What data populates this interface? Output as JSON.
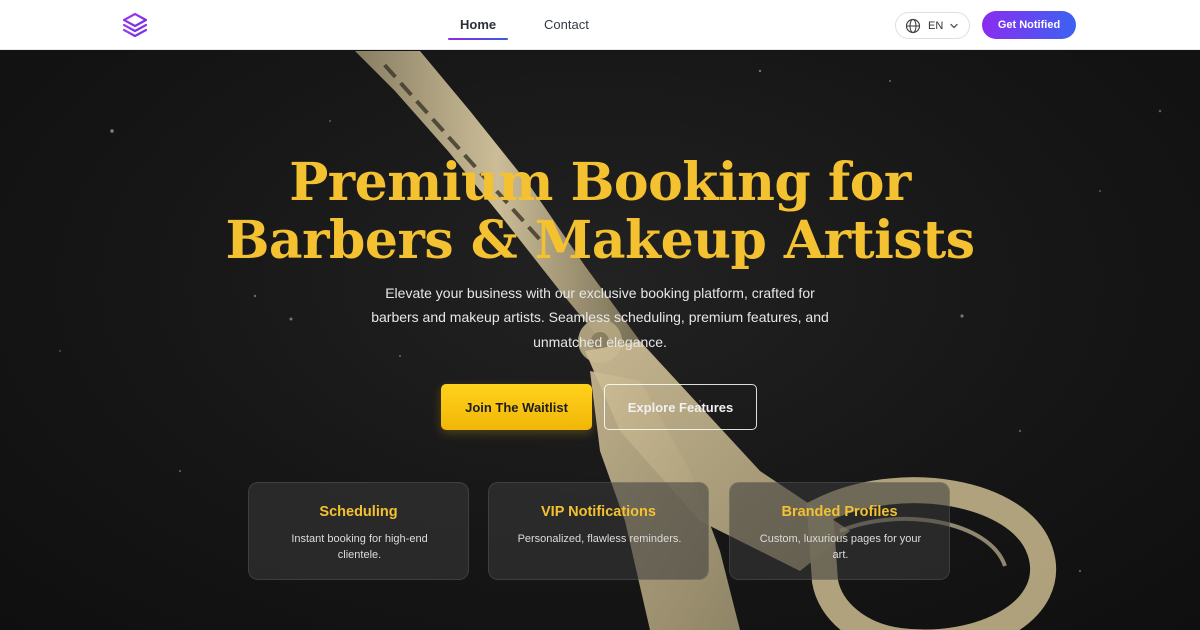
{
  "nav": {
    "logo_icon": "layers-icon",
    "links": [
      {
        "label": "Home",
        "active": true
      },
      {
        "label": "Contact",
        "active": false
      }
    ],
    "language": {
      "code": "EN",
      "icon": "globe-icon"
    },
    "cta_label": "Get Notified"
  },
  "hero": {
    "title_lines": [
      "Premium Booking for",
      "Barbers & Makeup Artists"
    ],
    "description_lines": [
      "Elevate your business with our exclusive booking platform, crafted for",
      "barbers and makeup artists. Seamless scheduling, premium features, and",
      "unmatched elegance."
    ],
    "primary_button": "Join The Waitlist",
    "secondary_button": "Explore Features"
  },
  "features": [
    {
      "title": "Scheduling",
      "desc_lines": [
        "Instant booking for high-end",
        "clientele."
      ]
    },
    {
      "title": "VIP Notifications",
      "desc_lines": [
        "Personalized, flawless reminders.",
        ""
      ]
    },
    {
      "title": "Branded Profiles",
      "desc_lines": [
        "Custom, luxurious pages for your",
        "art."
      ]
    }
  ],
  "colors": {
    "accent_gold": "#f4c230",
    "cta_gradient_start": "#8b2cf0",
    "cta_gradient_end": "#3b63f2",
    "hero_background": "#141414"
  }
}
